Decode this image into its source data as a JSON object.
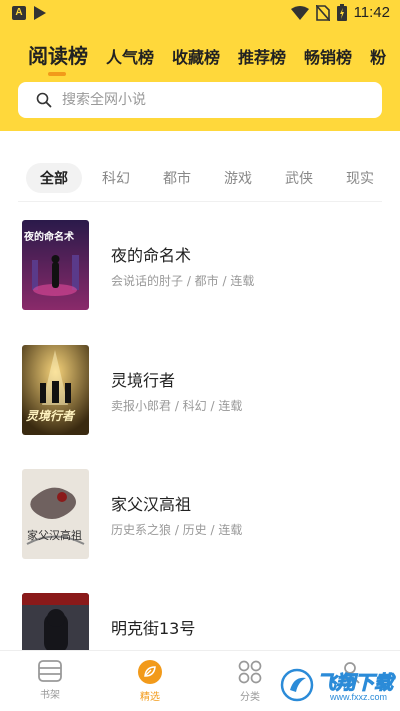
{
  "status_bar": {
    "time": "11:42"
  },
  "rank_tabs": [
    "阅读榜",
    "人气榜",
    "收藏榜",
    "推荐榜",
    "畅销榜",
    "粉"
  ],
  "search": {
    "placeholder": "搜索全网小说"
  },
  "categories": [
    "全部",
    "科幻",
    "都市",
    "游戏",
    "武侠",
    "现实"
  ],
  "books": [
    {
      "title": "夜的命名术",
      "meta": "会说话的肘子 / 都市 / 连载",
      "cover_text": "夜的命名术"
    },
    {
      "title": "灵境行者",
      "meta": "卖报小郎君 / 科幻 / 连载",
      "cover_text": "灵境行者"
    },
    {
      "title": "家父汉高祖",
      "meta": "历史系之狼 / 历史 / 连载",
      "cover_text": "家父汉高祖"
    },
    {
      "title": "明克街13号",
      "meta": "",
      "cover_text": ""
    }
  ],
  "bottom_nav": [
    {
      "label": "书架",
      "icon": "bookshelf-icon"
    },
    {
      "label": "精选",
      "icon": "leaf-icon"
    },
    {
      "label": "分类",
      "icon": "category-icon"
    },
    {
      "label": "",
      "icon": "user-icon"
    }
  ],
  "watermark": {
    "text": "飞翔下载",
    "url": "www.fxxz.com"
  },
  "colors": {
    "header_yellow": "#FFD83B",
    "accent_orange": "#F29A1A"
  }
}
